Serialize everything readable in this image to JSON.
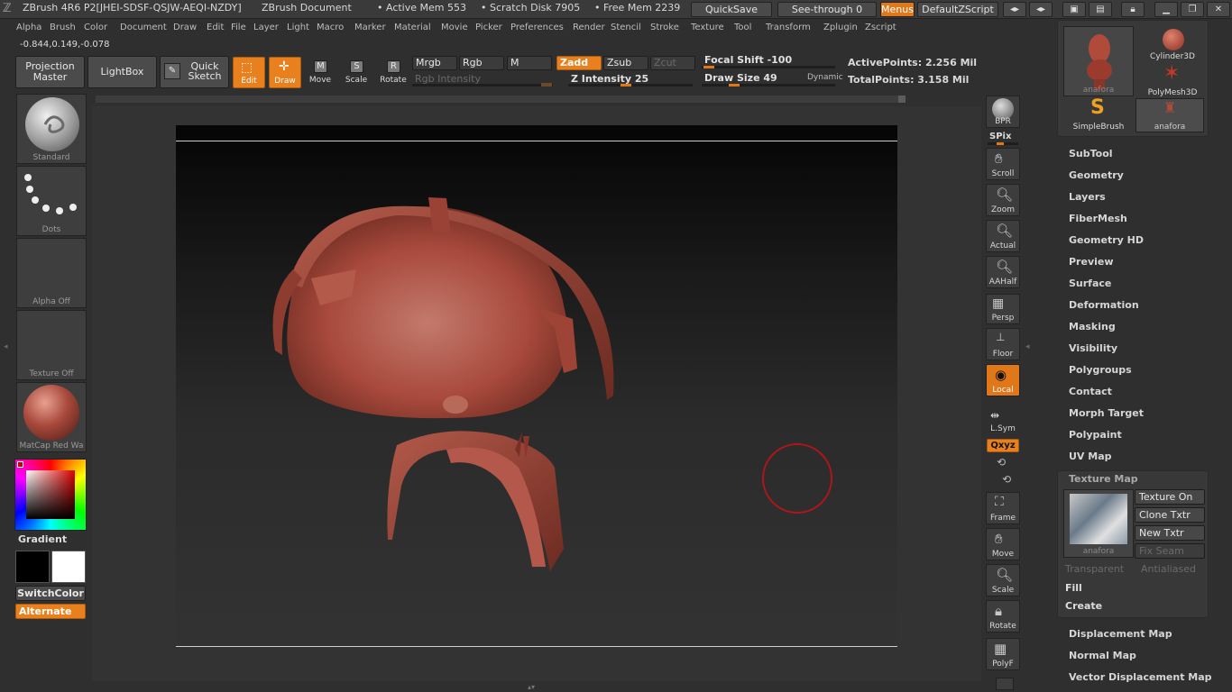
{
  "titlebar": {
    "app": "ZBrush 4R6 P2[JHEI-SDSF-QSJW-AEQI-NZDY]",
    "document": "ZBrush Document",
    "active_mem": "• Active Mem 553",
    "scratch_disk": "• Scratch Disk 7905",
    "free_mem": "• Free Mem 2239",
    "quicksave": "QuickSave",
    "see_through": "See-through  0",
    "menus": "Menus",
    "default_zscript": "DefaultZScript"
  },
  "menubar": [
    "Alpha",
    "Brush",
    "Color",
    "Document",
    "Draw",
    "Edit",
    "File",
    "Layer",
    "Light",
    "Macro",
    "Marker",
    "Material",
    "Movie",
    "Picker",
    "Preferences",
    "Render",
    "Stencil",
    "Stroke",
    "Texture",
    "Tool",
    "Transform",
    "Zplugin",
    "Zscript"
  ],
  "coords": "-0.844,0.149,-0.078",
  "toolbar": {
    "projection_master": "Projection Master",
    "lightbox": "LightBox",
    "quick_sketch": "Quick Sketch",
    "edit": "Edit",
    "draw": "Draw",
    "move": "Move",
    "scale": "Scale",
    "rotate": "Rotate",
    "mrgb": "Mrgb",
    "rgb": "Rgb",
    "m": "M",
    "zadd": "Zadd",
    "zsub": "Zsub",
    "zcut": "Zcut",
    "rgb_intensity": "Rgb Intensity",
    "z_intensity": "Z Intensity 25",
    "focal_shift": "Focal Shift -100",
    "draw_size": "Draw Size 49",
    "dynamic": "Dynamic",
    "active_points": "ActivePoints: 2.256  Mil",
    "total_points": "TotalPoints: 3.158  Mil"
  },
  "left_shelf": {
    "brush": "Standard",
    "stroke": "Dots",
    "alpha": "Alpha  Off",
    "texture": "Texture  Off",
    "material": "MatCap  Red  Wa",
    "gradient": "Gradient",
    "switch_color": "SwitchColor",
    "alternate": "Alternate"
  },
  "right_shelf": {
    "bpr": "BPR",
    "spix": "SPix",
    "scroll": "Scroll",
    "zoom": "Zoom",
    "actual": "Actual",
    "aahalf": "AAHalf",
    "persp": "Persp",
    "floor": "Floor",
    "local": "Local",
    "lsym": "L.Sym",
    "xyz": "Qxyz",
    "frame": "Frame",
    "move": "Move",
    "scale": "Scale",
    "rotate": "Rotate",
    "polyf": "PolyF"
  },
  "tool_thumbs": {
    "anafora_big": "anafora",
    "cylinder": "Cylinder3D",
    "polymesh": "PolyMesh3D",
    "simplebrush": "SimpleBrush",
    "anafora_small": "anafora"
  },
  "palette": [
    "SubTool",
    "Geometry",
    "Layers",
    "FiberMesh",
    "Geometry HD",
    "Preview",
    "Surface",
    "Deformation",
    "Masking",
    "Visibility",
    "Polygroups",
    "Contact",
    "Morph Target",
    "Polypaint",
    "UV Map"
  ],
  "texture_map": {
    "title": "Texture Map",
    "thumb_label": "anafora",
    "texture_on": "Texture On",
    "clone_txtr": "Clone Txtr",
    "new_txtr": "New Txtr",
    "fix_seam": "Fix Seam",
    "transparent": "Transparent",
    "antialiased": "Antialiased",
    "fill": "Fill",
    "create": "Create"
  },
  "palette_bottom": [
    "Displacement Map",
    "Normal Map",
    "Vector Displacement Map"
  ],
  "colors": {
    "accent": "#e0781a",
    "mesh": "#a8493c"
  }
}
